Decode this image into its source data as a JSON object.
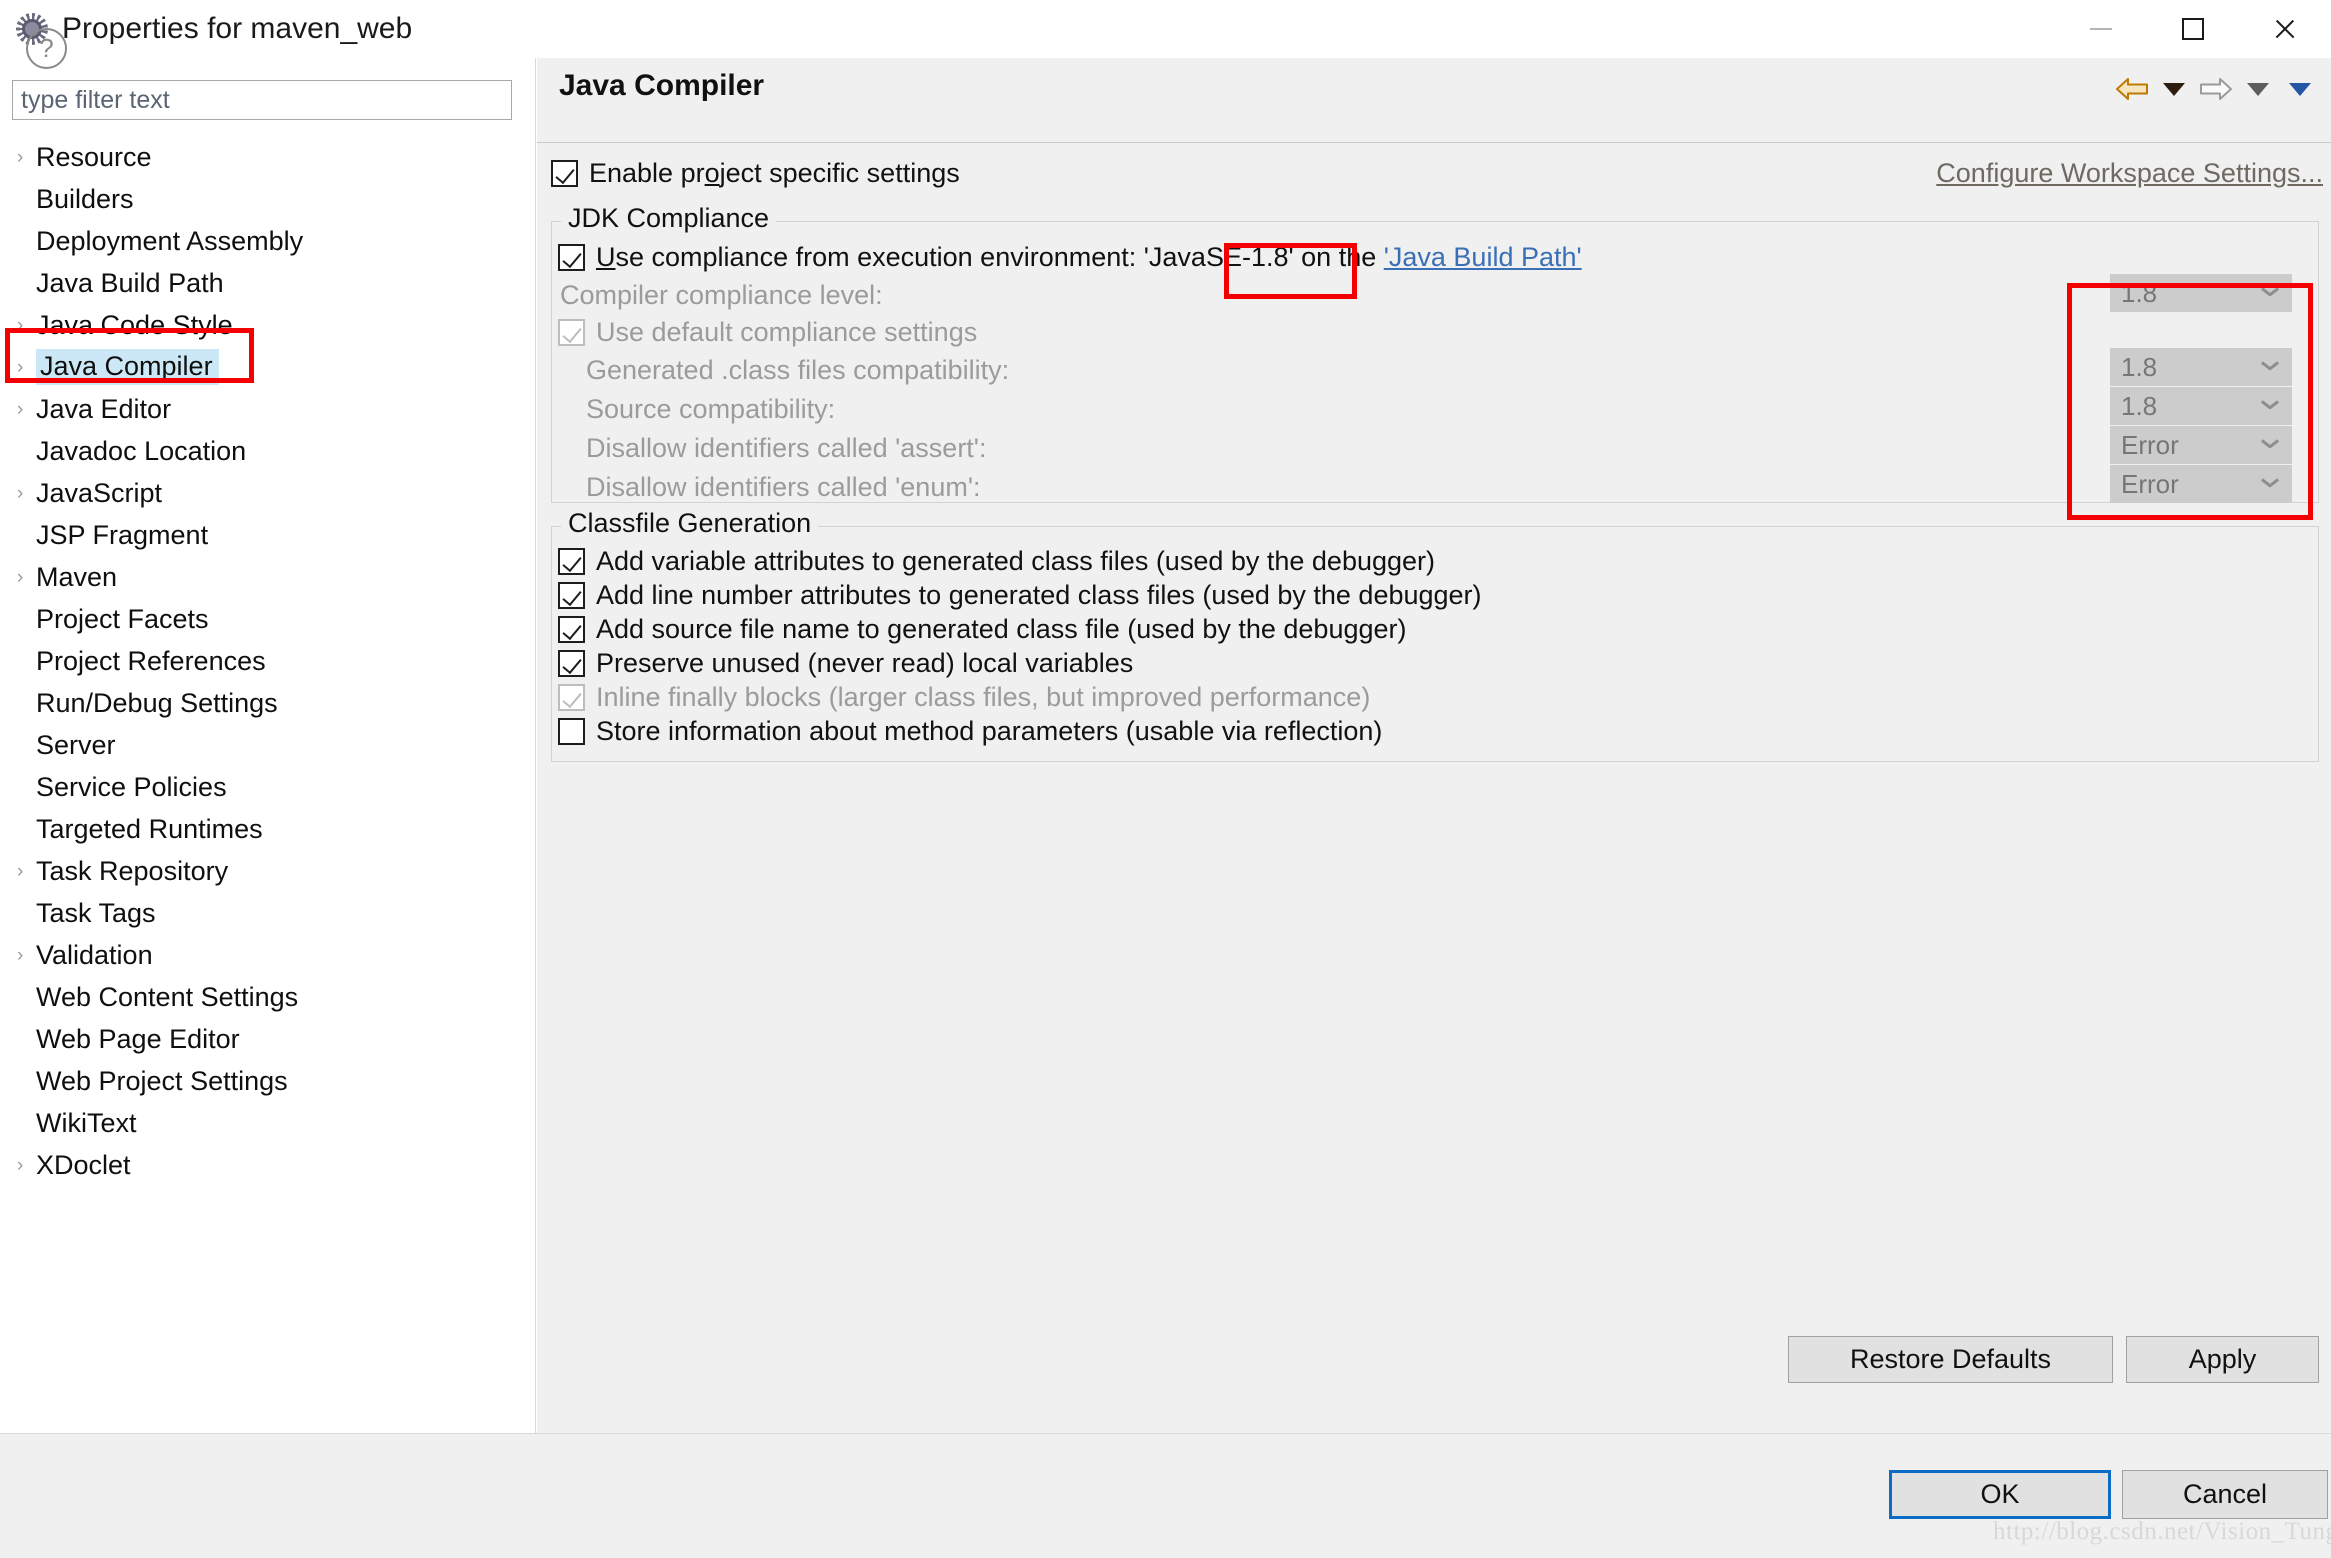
{
  "window": {
    "title": "Properties for maven_web",
    "icon": "eclipse-gear-icon",
    "minimize_label": "—",
    "maximize_label": "□",
    "close_label": "✕"
  },
  "sidebar": {
    "filter": {
      "value": "",
      "placeholder": "type filter text"
    },
    "items": [
      {
        "label": "Resource",
        "expandable": true,
        "selected": false
      },
      {
        "label": "Builders",
        "expandable": false,
        "selected": false
      },
      {
        "label": "Deployment Assembly",
        "expandable": false,
        "selected": false
      },
      {
        "label": "Java Build Path",
        "expandable": false,
        "selected": false
      },
      {
        "label": "Java Code Style",
        "expandable": true,
        "selected": false
      },
      {
        "label": "Java Compiler",
        "expandable": true,
        "selected": true
      },
      {
        "label": "Java Editor",
        "expandable": true,
        "selected": false
      },
      {
        "label": "Javadoc Location",
        "expandable": false,
        "selected": false
      },
      {
        "label": "JavaScript",
        "expandable": true,
        "selected": false
      },
      {
        "label": "JSP Fragment",
        "expandable": false,
        "selected": false
      },
      {
        "label": "Maven",
        "expandable": true,
        "selected": false
      },
      {
        "label": "Project Facets",
        "expandable": false,
        "selected": false
      },
      {
        "label": "Project References",
        "expandable": false,
        "selected": false
      },
      {
        "label": "Run/Debug Settings",
        "expandable": false,
        "selected": false
      },
      {
        "label": "Server",
        "expandable": false,
        "selected": false
      },
      {
        "label": "Service Policies",
        "expandable": false,
        "selected": false
      },
      {
        "label": "Targeted Runtimes",
        "expandable": false,
        "selected": false
      },
      {
        "label": "Task Repository",
        "expandable": true,
        "selected": false
      },
      {
        "label": "Task Tags",
        "expandable": false,
        "selected": false
      },
      {
        "label": "Validation",
        "expandable": true,
        "selected": false
      },
      {
        "label": "Web Content Settings",
        "expandable": false,
        "selected": false
      },
      {
        "label": "Web Page Editor",
        "expandable": false,
        "selected": false
      },
      {
        "label": "Web Project Settings",
        "expandable": false,
        "selected": false
      },
      {
        "label": "WikiText",
        "expandable": false,
        "selected": false
      },
      {
        "label": "XDoclet",
        "expandable": true,
        "selected": false
      }
    ]
  },
  "content": {
    "title": "Java Compiler",
    "nav": {
      "back_icon": "back-arrow-icon",
      "back_menu_icon": "chevron-down-icon",
      "forward_icon": "forward-arrow-icon",
      "forward_menu_icon": "chevron-down-icon",
      "view_menu_icon": "chevron-down-icon"
    },
    "enable_project_specific": {
      "label_pre": "Enable pr",
      "label_mnemonic": "o",
      "label_post": "ject specific settings",
      "checked": true
    },
    "configure_workspace_link": "Configure Workspace Settings...",
    "jdk_compliance": {
      "title": "JDK Compliance",
      "use_execution_env": {
        "checked": true,
        "text_pre": "U",
        "text_mnemonic": "",
        "text_1": "se compliance from execution environment: ",
        "env_value": "'JavaSE-1.8'",
        "text_2": " on the ",
        "link": "'Java Build Path'"
      },
      "rows": [
        {
          "label": "Compiler compliance level:",
          "mnemonic_at": 7,
          "value": "1.8",
          "disabled": true,
          "has_combo": true
        },
        {
          "label": "Use default compliance settings",
          "mnemonic_at": 14,
          "value": "",
          "disabled": true,
          "has_combo": false,
          "is_checkbox": true,
          "checked": true
        },
        {
          "label": "Generated .class files compatibility:",
          "mnemonic_at": 3,
          "value": "1.8",
          "disabled": true,
          "has_combo": true
        },
        {
          "label": "Source compatibility:",
          "mnemonic_at": 9,
          "value": "1.8",
          "disabled": true,
          "has_combo": true
        },
        {
          "label": "Disallow identifiers called 'assert':",
          "mnemonic_at": 18,
          "value": "Error",
          "disabled": true,
          "has_combo": true
        },
        {
          "label": "Disallow identifiers called 'enum':",
          "mnemonic_at": -1,
          "value": "Error",
          "disabled": true,
          "has_combo": true
        }
      ]
    },
    "classfile_generation": {
      "title": "Classfile Generation",
      "items": [
        {
          "label": "Add variable attributes to generated class files (used by the debugger)",
          "checked": true,
          "disabled": false
        },
        {
          "label": "Add line number attributes to generated class files (used by the debugger)",
          "checked": true,
          "disabled": false
        },
        {
          "label": "Add source file name to generated class file (used by the debugger)",
          "checked": true,
          "disabled": false
        },
        {
          "label": "Preserve unused (never read) local variables",
          "checked": true,
          "disabled": false
        },
        {
          "label": "Inline finally blocks (larger class files, but improved performance)",
          "checked": true,
          "disabled": true
        },
        {
          "label": "Store information about method parameters (usable via reflection)",
          "checked": false,
          "disabled": false
        }
      ]
    },
    "buttons": {
      "restore_defaults": "Restore Defaults",
      "apply": "Apply"
    }
  },
  "footer": {
    "help_icon": "question-mark-icon",
    "help_glyph": "?",
    "ok": "OK",
    "cancel": "Cancel",
    "watermark": "http://blog.csdn.net/Vision_Tung"
  },
  "annotations": {
    "highlight_color": "#f40000",
    "boxes": [
      "sidebar-java-compiler",
      "execution-environment-value",
      "compliance-combos"
    ]
  }
}
